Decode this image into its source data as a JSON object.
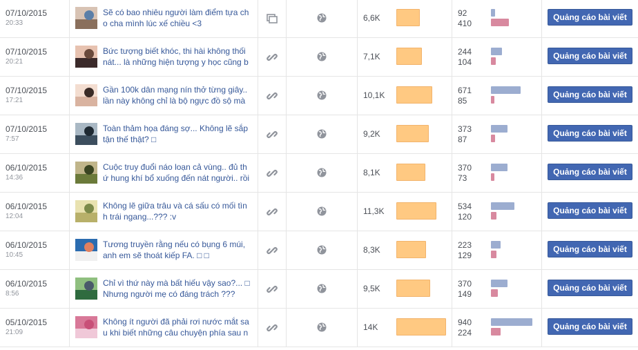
{
  "colors": {
    "link_text": "#365899",
    "reach_bar": "#ffc982",
    "engagement_a_bar": "#9cadd0",
    "engagement_b_bar": "#d8899f",
    "boost_button": "#4267b2"
  },
  "boost_label": "Quảng cáo bài viết",
  "posts": [
    {
      "date": "07/10/2015",
      "time": "20:33",
      "line1": "Sẽ có bao nhiêu người làm điểm tựa ch",
      "line2": "o cha mình lúc xế chiều <3",
      "type_icon": "album-icon",
      "privacy_icon": "globe-icon",
      "reach": "6,6K",
      "reach_value": 6600,
      "eng_a": "92",
      "eng_b": "410"
    },
    {
      "date": "07/10/2015",
      "time": "20:21",
      "line1": "Bức tượng biết khóc, thi hài không thối",
      "line2": "nát... là những hiện tượng y học cũng b",
      "type_icon": "link-icon",
      "privacy_icon": "globe-icon",
      "reach": "7,1K",
      "reach_value": 7100,
      "eng_a": "244",
      "eng_b": "104"
    },
    {
      "date": "07/10/2015",
      "time": "17:21",
      "line1": "Gần 100k dân mạng nín thở từng giây..",
      "line2": "lần này không chỉ là bộ ngực đồ sộ mà",
      "type_icon": "link-icon",
      "privacy_icon": "globe-icon",
      "reach": "10,1K",
      "reach_value": 10100,
      "eng_a": "671",
      "eng_b": "85"
    },
    {
      "date": "07/10/2015",
      "time": "7:57",
      "line1": "Toàn thảm họa đáng sợ... Không lẽ sắp",
      "line2": "tận thế thật? □",
      "type_icon": "link-icon",
      "privacy_icon": "globe-icon",
      "reach": "9,2K",
      "reach_value": 9200,
      "eng_a": "373",
      "eng_b": "87"
    },
    {
      "date": "06/10/2015",
      "time": "14:36",
      "line1": "Cuộc truy đuổi náo loạn cả vùng.. đủ th",
      "line2": "ứ hung khí bổ xuống đến nát người.. rồi",
      "type_icon": "link-icon",
      "privacy_icon": "globe-icon",
      "reach": "8,1K",
      "reach_value": 8100,
      "eng_a": "370",
      "eng_b": "73"
    },
    {
      "date": "06/10/2015",
      "time": "12:04",
      "line1": "Không lẽ giữa trâu và cá sấu có mối tìn",
      "line2": "h trái ngang...??? :v",
      "type_icon": "link-icon",
      "privacy_icon": "globe-icon",
      "reach": "11,3K",
      "reach_value": 11300,
      "eng_a": "534",
      "eng_b": "120"
    },
    {
      "date": "06/10/2015",
      "time": "10:45",
      "line1": "Tương truyền rằng nếu có bụng 6 múi,",
      "line2": "anh em sẽ thoát kiếp FA. □ □",
      "type_icon": "link-icon",
      "privacy_icon": "globe-icon",
      "reach": "8,3K",
      "reach_value": 8300,
      "eng_a": "223",
      "eng_b": "129"
    },
    {
      "date": "06/10/2015",
      "time": "8:56",
      "line1": "Chỉ vì thứ này mà bất hiếu vậy sao?... □",
      "line2": "Nhưng người mẹ có đáng trách ???",
      "type_icon": "link-icon",
      "privacy_icon": "globe-icon",
      "reach": "9,5K",
      "reach_value": 9500,
      "eng_a": "370",
      "eng_b": "149"
    },
    {
      "date": "05/10/2015",
      "time": "21:09",
      "line1": "Không ít người đã phải rơi nước mắt sa",
      "line2": "u khi biết những câu chuyện phía sau n",
      "type_icon": "link-icon",
      "privacy_icon": "globe-icon",
      "reach": "14K",
      "reach_value": 14000,
      "eng_a": "940",
      "eng_b": "224"
    }
  ]
}
